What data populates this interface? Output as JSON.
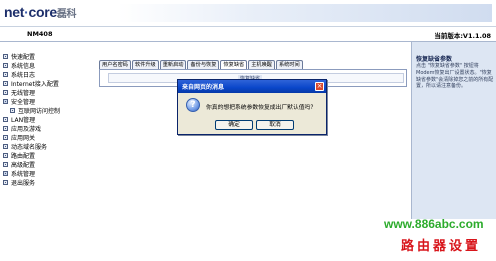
{
  "header": {
    "logo_main": "net",
    "logo_dot": "·",
    "logo_core": "core",
    "logo_cn": "磊科",
    "model": "NM408",
    "version": "当前版本:V1.1.08"
  },
  "sidebar": {
    "items": [
      {
        "label": "快速配置"
      },
      {
        "label": "系统信息"
      },
      {
        "label": "系统日志"
      },
      {
        "label": "Internet接入配置"
      },
      {
        "label": "无线管理"
      },
      {
        "label": "安全管理"
      },
      {
        "label": "互联网访问控制"
      },
      {
        "label": "LAN管理"
      },
      {
        "label": "应用及游戏"
      },
      {
        "label": "应用网关"
      },
      {
        "label": "动态域名服务"
      },
      {
        "label": "路由配置"
      },
      {
        "label": "高级配置"
      },
      {
        "label": "系统管理"
      },
      {
        "label": "退出服务"
      }
    ]
  },
  "main": {
    "tabs": [
      {
        "label": "用户名密码"
      },
      {
        "label": "软件升级"
      },
      {
        "label": "重新启动"
      },
      {
        "label": "备份与恢复"
      },
      {
        "label": "恢复缺省"
      },
      {
        "label": "主机唤醒"
      },
      {
        "label": "系统时间"
      }
    ],
    "panel_title": "恢复缺省"
  },
  "help": {
    "title": "恢复缺省参数",
    "text": "点击 \"恢复缺省参数\" 按钮将Modem恢复出厂设置状态。\"恢复缺省参数\"会清除掉您之前的所有配置，所以请注意备份。"
  },
  "dialog": {
    "title": "来自网页的消息",
    "close_glyph": "×",
    "icon_glyph": "?",
    "message": "你真的想把系统参数恢复成出厂默认值吗？",
    "ok_label": "确定",
    "cancel_label": "取消"
  },
  "watermark": {
    "url": "www.886abc.com",
    "cn": "路由器设置"
  },
  "colors": {
    "titlebar": "#0a46c9",
    "help_bg": "#dde6f3",
    "watermark_url": "#2cab2c",
    "watermark_cn": "#d8151b"
  },
  "icons": {
    "dialog_icon": "question-icon",
    "close": "close-icon",
    "menu_item": "folder-icon"
  }
}
